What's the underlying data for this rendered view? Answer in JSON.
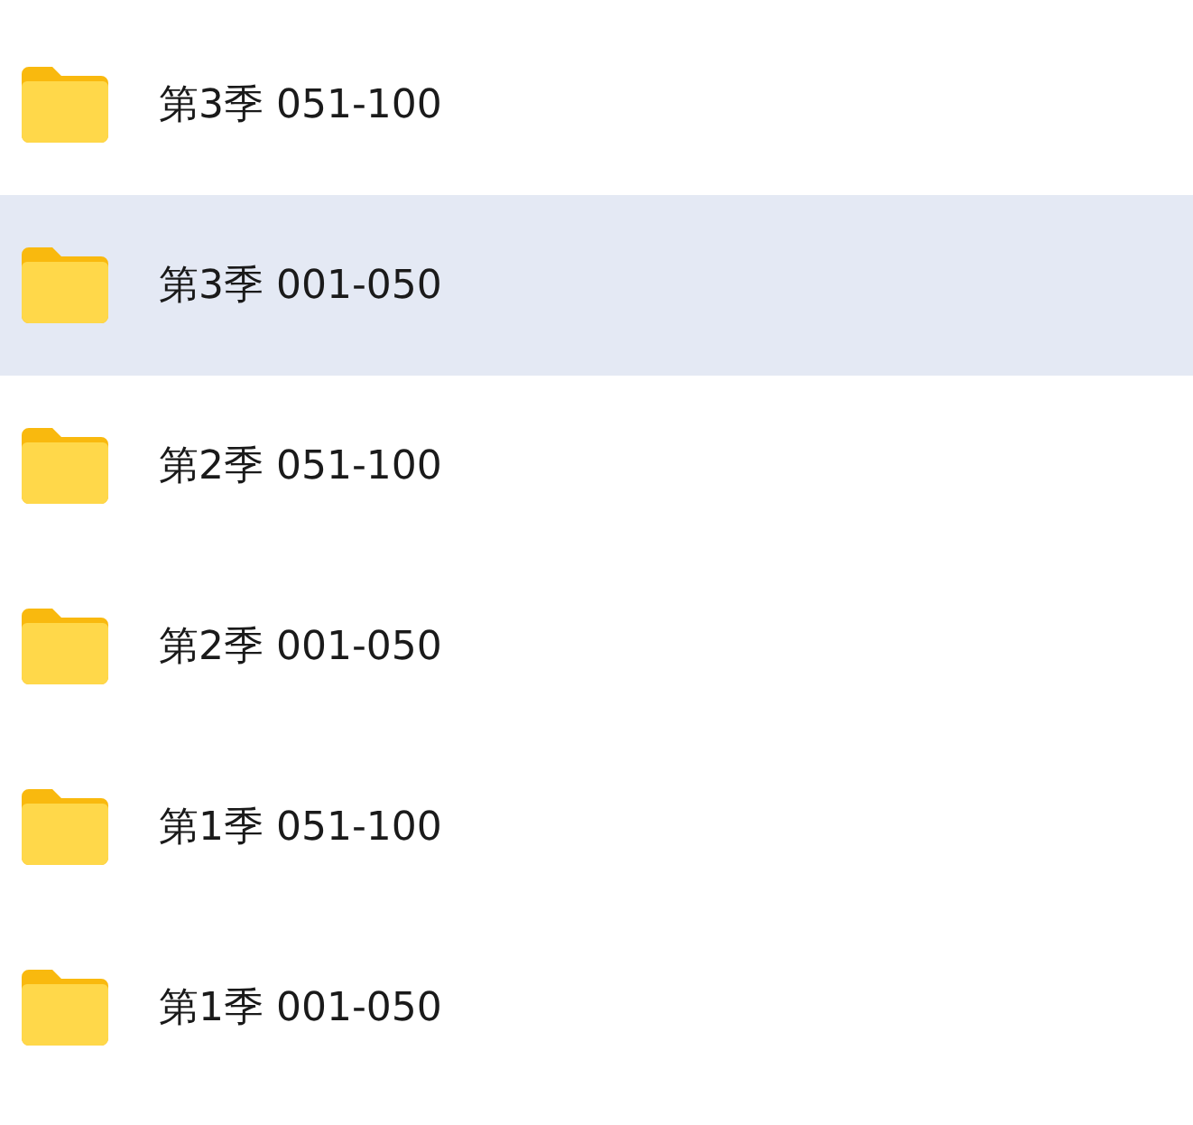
{
  "folders": [
    {
      "name": "第3季 051-100",
      "selected": false
    },
    {
      "name": "第3季 001-050",
      "selected": true
    },
    {
      "name": "第2季 051-100",
      "selected": false
    },
    {
      "name": "第2季 001-050",
      "selected": false
    },
    {
      "name": "第1季 051-100",
      "selected": false
    },
    {
      "name": "第1季 001-050",
      "selected": false
    }
  ]
}
